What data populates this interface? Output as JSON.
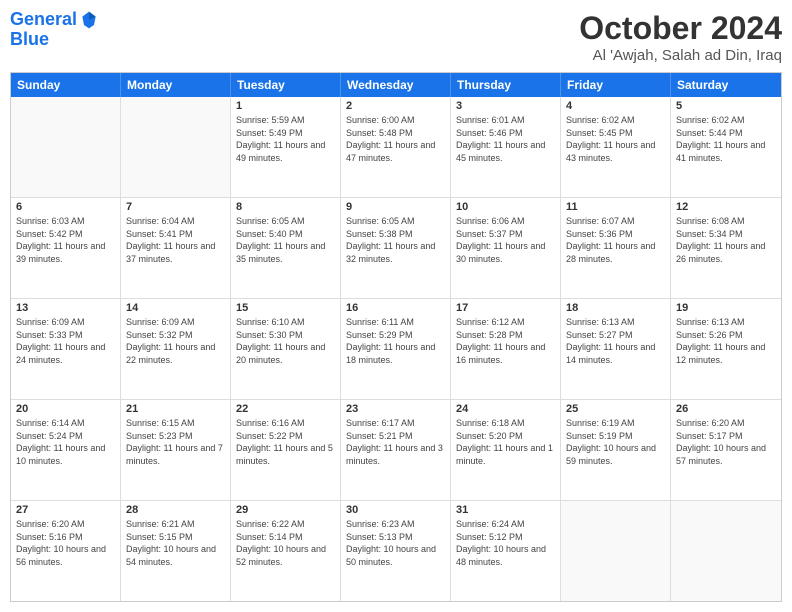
{
  "header": {
    "logo_line1": "General",
    "logo_line2": "Blue",
    "month": "October 2024",
    "location": "Al 'Awjah, Salah ad Din, Iraq"
  },
  "days_of_week": [
    "Sunday",
    "Monday",
    "Tuesday",
    "Wednesday",
    "Thursday",
    "Friday",
    "Saturday"
  ],
  "weeks": [
    [
      {
        "day": "",
        "info": ""
      },
      {
        "day": "",
        "info": ""
      },
      {
        "day": "1",
        "info": "Sunrise: 5:59 AM\nSunset: 5:49 PM\nDaylight: 11 hours and 49 minutes."
      },
      {
        "day": "2",
        "info": "Sunrise: 6:00 AM\nSunset: 5:48 PM\nDaylight: 11 hours and 47 minutes."
      },
      {
        "day": "3",
        "info": "Sunrise: 6:01 AM\nSunset: 5:46 PM\nDaylight: 11 hours and 45 minutes."
      },
      {
        "day": "4",
        "info": "Sunrise: 6:02 AM\nSunset: 5:45 PM\nDaylight: 11 hours and 43 minutes."
      },
      {
        "day": "5",
        "info": "Sunrise: 6:02 AM\nSunset: 5:44 PM\nDaylight: 11 hours and 41 minutes."
      }
    ],
    [
      {
        "day": "6",
        "info": "Sunrise: 6:03 AM\nSunset: 5:42 PM\nDaylight: 11 hours and 39 minutes."
      },
      {
        "day": "7",
        "info": "Sunrise: 6:04 AM\nSunset: 5:41 PM\nDaylight: 11 hours and 37 minutes."
      },
      {
        "day": "8",
        "info": "Sunrise: 6:05 AM\nSunset: 5:40 PM\nDaylight: 11 hours and 35 minutes."
      },
      {
        "day": "9",
        "info": "Sunrise: 6:05 AM\nSunset: 5:38 PM\nDaylight: 11 hours and 32 minutes."
      },
      {
        "day": "10",
        "info": "Sunrise: 6:06 AM\nSunset: 5:37 PM\nDaylight: 11 hours and 30 minutes."
      },
      {
        "day": "11",
        "info": "Sunrise: 6:07 AM\nSunset: 5:36 PM\nDaylight: 11 hours and 28 minutes."
      },
      {
        "day": "12",
        "info": "Sunrise: 6:08 AM\nSunset: 5:34 PM\nDaylight: 11 hours and 26 minutes."
      }
    ],
    [
      {
        "day": "13",
        "info": "Sunrise: 6:09 AM\nSunset: 5:33 PM\nDaylight: 11 hours and 24 minutes."
      },
      {
        "day": "14",
        "info": "Sunrise: 6:09 AM\nSunset: 5:32 PM\nDaylight: 11 hours and 22 minutes."
      },
      {
        "day": "15",
        "info": "Sunrise: 6:10 AM\nSunset: 5:30 PM\nDaylight: 11 hours and 20 minutes."
      },
      {
        "day": "16",
        "info": "Sunrise: 6:11 AM\nSunset: 5:29 PM\nDaylight: 11 hours and 18 minutes."
      },
      {
        "day": "17",
        "info": "Sunrise: 6:12 AM\nSunset: 5:28 PM\nDaylight: 11 hours and 16 minutes."
      },
      {
        "day": "18",
        "info": "Sunrise: 6:13 AM\nSunset: 5:27 PM\nDaylight: 11 hours and 14 minutes."
      },
      {
        "day": "19",
        "info": "Sunrise: 6:13 AM\nSunset: 5:26 PM\nDaylight: 11 hours and 12 minutes."
      }
    ],
    [
      {
        "day": "20",
        "info": "Sunrise: 6:14 AM\nSunset: 5:24 PM\nDaylight: 11 hours and 10 minutes."
      },
      {
        "day": "21",
        "info": "Sunrise: 6:15 AM\nSunset: 5:23 PM\nDaylight: 11 hours and 7 minutes."
      },
      {
        "day": "22",
        "info": "Sunrise: 6:16 AM\nSunset: 5:22 PM\nDaylight: 11 hours and 5 minutes."
      },
      {
        "day": "23",
        "info": "Sunrise: 6:17 AM\nSunset: 5:21 PM\nDaylight: 11 hours and 3 minutes."
      },
      {
        "day": "24",
        "info": "Sunrise: 6:18 AM\nSunset: 5:20 PM\nDaylight: 11 hours and 1 minute."
      },
      {
        "day": "25",
        "info": "Sunrise: 6:19 AM\nSunset: 5:19 PM\nDaylight: 10 hours and 59 minutes."
      },
      {
        "day": "26",
        "info": "Sunrise: 6:20 AM\nSunset: 5:17 PM\nDaylight: 10 hours and 57 minutes."
      }
    ],
    [
      {
        "day": "27",
        "info": "Sunrise: 6:20 AM\nSunset: 5:16 PM\nDaylight: 10 hours and 56 minutes."
      },
      {
        "day": "28",
        "info": "Sunrise: 6:21 AM\nSunset: 5:15 PM\nDaylight: 10 hours and 54 minutes."
      },
      {
        "day": "29",
        "info": "Sunrise: 6:22 AM\nSunset: 5:14 PM\nDaylight: 10 hours and 52 minutes."
      },
      {
        "day": "30",
        "info": "Sunrise: 6:23 AM\nSunset: 5:13 PM\nDaylight: 10 hours and 50 minutes."
      },
      {
        "day": "31",
        "info": "Sunrise: 6:24 AM\nSunset: 5:12 PM\nDaylight: 10 hours and 48 minutes."
      },
      {
        "day": "",
        "info": ""
      },
      {
        "day": "",
        "info": ""
      }
    ]
  ]
}
